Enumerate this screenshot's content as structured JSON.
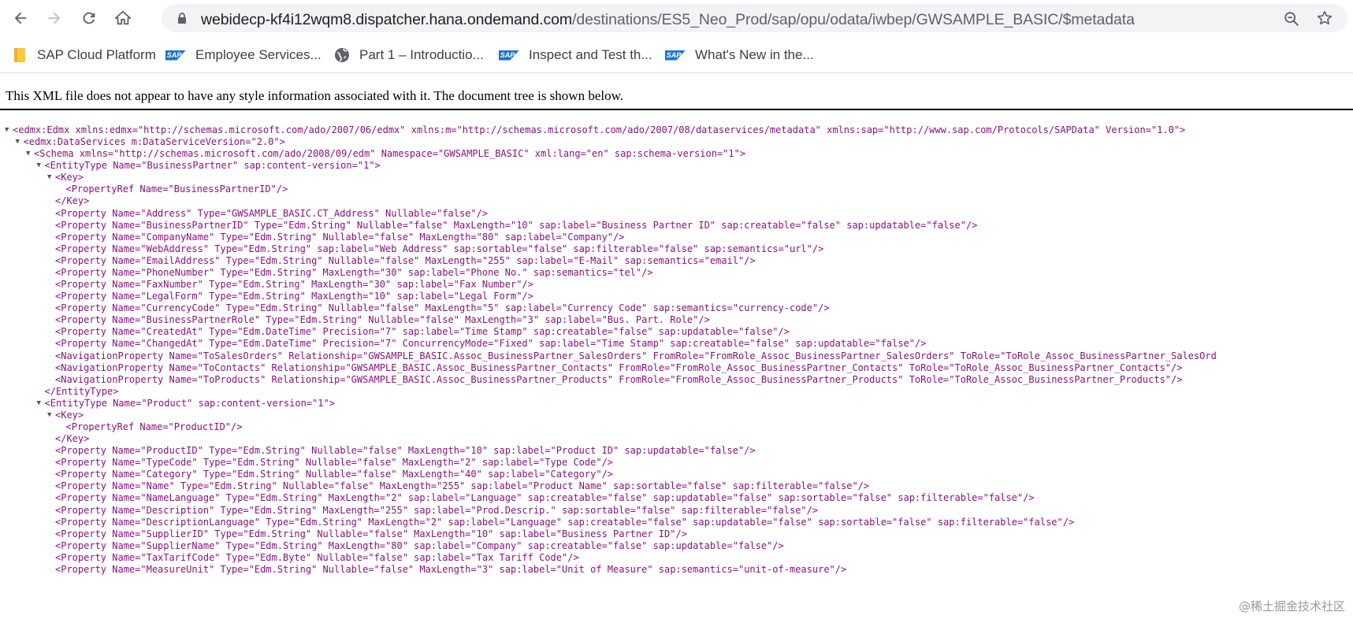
{
  "browser": {
    "url_host": "webidecp-kf4i12wqm8.dispatcher.hana.ondemand.com",
    "url_path": "/destinations/ES5_Neo_Prod/sap/opu/odata/iwbep/GWSAMPLE_BASIC/$metadata",
    "icons": {
      "back": "back-arrow-icon",
      "forward": "forward-arrow-icon",
      "reload": "reload-icon",
      "home": "home-icon",
      "lock": "lock-icon",
      "zoom": "zoom-out-icon",
      "star": "bookmark-star-icon"
    }
  },
  "bookmarks": [
    {
      "label": "SAP Cloud Platform",
      "icon": "folder-icon"
    },
    {
      "label": "Employee Services...",
      "icon": "sap-logo-icon"
    },
    {
      "label": "Part 1 – Introductio...",
      "icon": "globe-icon"
    },
    {
      "label": "Inspect and Test th...",
      "icon": "sap-logo-icon"
    },
    {
      "label": "What's New in the...",
      "icon": "sap-logo-icon"
    }
  ],
  "notice": "This XML file does not appear to have any style information associated with it. The document tree is shown below.",
  "xml_lines": [
    {
      "text": "<edmx:Edmx xmlns:edmx=\"http://schemas.microsoft.com/ado/2007/06/edmx\" xmlns:m=\"http://schemas.microsoft.com/ado/2007/08/dataservices/metadata\" xmlns:sap=\"http://www.sap.com/Protocols/SAPData\" Version=\"1.0\">",
      "level": 0,
      "toggle": true
    },
    {
      "text": "<edmx:DataServices m:DataServiceVersion=\"2.0\">",
      "level": 1,
      "toggle": true
    },
    {
      "text": "<Schema xmlns=\"http://schemas.microsoft.com/ado/2008/09/edm\" Namespace=\"GWSAMPLE_BASIC\" xml:lang=\"en\" sap:schema-version=\"1\">",
      "level": 2,
      "toggle": true
    },
    {
      "text": "<EntityType Name=\"BusinessPartner\" sap:content-version=\"1\">",
      "level": 3,
      "toggle": true
    },
    {
      "text": "<Key>",
      "level": 4,
      "toggle": true
    },
    {
      "text": "<PropertyRef Name=\"BusinessPartnerID\"/>",
      "level": 5,
      "toggle": false
    },
    {
      "text": "</Key>",
      "level": 4,
      "toggle": false
    },
    {
      "text": "<Property Name=\"Address\" Type=\"GWSAMPLE_BASIC.CT_Address\" Nullable=\"false\"/>",
      "level": 4,
      "toggle": false
    },
    {
      "text": "<Property Name=\"BusinessPartnerID\" Type=\"Edm.String\" Nullable=\"false\" MaxLength=\"10\" sap:label=\"Business Partner ID\" sap:creatable=\"false\" sap:updatable=\"false\"/>",
      "level": 4,
      "toggle": false
    },
    {
      "text": "<Property Name=\"CompanyName\" Type=\"Edm.String\" Nullable=\"false\" MaxLength=\"80\" sap:label=\"Company\"/>",
      "level": 4,
      "toggle": false
    },
    {
      "text": "<Property Name=\"WebAddress\" Type=\"Edm.String\" sap:label=\"Web Address\" sap:sortable=\"false\" sap:filterable=\"false\" sap:semantics=\"url\"/>",
      "level": 4,
      "toggle": false
    },
    {
      "text": "<Property Name=\"EmailAddress\" Type=\"Edm.String\" Nullable=\"false\" MaxLength=\"255\" sap:label=\"E-Mail\" sap:semantics=\"email\"/>",
      "level": 4,
      "toggle": false
    },
    {
      "text": "<Property Name=\"PhoneNumber\" Type=\"Edm.String\" MaxLength=\"30\" sap:label=\"Phone No.\" sap:semantics=\"tel\"/>",
      "level": 4,
      "toggle": false
    },
    {
      "text": "<Property Name=\"FaxNumber\" Type=\"Edm.String\" MaxLength=\"30\" sap:label=\"Fax Number\"/>",
      "level": 4,
      "toggle": false
    },
    {
      "text": "<Property Name=\"LegalForm\" Type=\"Edm.String\" MaxLength=\"10\" sap:label=\"Legal Form\"/>",
      "level": 4,
      "toggle": false
    },
    {
      "text": "<Property Name=\"CurrencyCode\" Type=\"Edm.String\" Nullable=\"false\" MaxLength=\"5\" sap:label=\"Currency Code\" sap:semantics=\"currency-code\"/>",
      "level": 4,
      "toggle": false
    },
    {
      "text": "<Property Name=\"BusinessPartnerRole\" Type=\"Edm.String\" Nullable=\"false\" MaxLength=\"3\" sap:label=\"Bus. Part. Role\"/>",
      "level": 4,
      "toggle": false
    },
    {
      "text": "<Property Name=\"CreatedAt\" Type=\"Edm.DateTime\" Precision=\"7\" sap:label=\"Time Stamp\" sap:creatable=\"false\" sap:updatable=\"false\"/>",
      "level": 4,
      "toggle": false
    },
    {
      "text": "<Property Name=\"ChangedAt\" Type=\"Edm.DateTime\" Precision=\"7\" ConcurrencyMode=\"Fixed\" sap:label=\"Time Stamp\" sap:creatable=\"false\" sap:updatable=\"false\"/>",
      "level": 4,
      "toggle": false
    },
    {
      "text": "<NavigationProperty Name=\"ToSalesOrders\" Relationship=\"GWSAMPLE_BASIC.Assoc_BusinessPartner_SalesOrders\" FromRole=\"FromRole_Assoc_BusinessPartner_SalesOrders\" ToRole=\"ToRole_Assoc_BusinessPartner_SalesOrd",
      "level": 4,
      "toggle": false
    },
    {
      "text": "<NavigationProperty Name=\"ToContacts\" Relationship=\"GWSAMPLE_BASIC.Assoc_BusinessPartner_Contacts\" FromRole=\"FromRole_Assoc_BusinessPartner_Contacts\" ToRole=\"ToRole_Assoc_BusinessPartner_Contacts\"/>",
      "level": 4,
      "toggle": false
    },
    {
      "text": "<NavigationProperty Name=\"ToProducts\" Relationship=\"GWSAMPLE_BASIC.Assoc_BusinessPartner_Products\" FromRole=\"FromRole_Assoc_BusinessPartner_Products\" ToRole=\"ToRole_Assoc_BusinessPartner_Products\"/>",
      "level": 4,
      "toggle": false
    },
    {
      "text": "</EntityType>",
      "level": 3,
      "toggle": false
    },
    {
      "text": "<EntityType Name=\"Product\" sap:content-version=\"1\">",
      "level": 3,
      "toggle": true
    },
    {
      "text": "<Key>",
      "level": 4,
      "toggle": true
    },
    {
      "text": "<PropertyRef Name=\"ProductID\"/>",
      "level": 5,
      "toggle": false
    },
    {
      "text": "</Key>",
      "level": 4,
      "toggle": false
    },
    {
      "text": "<Property Name=\"ProductID\" Type=\"Edm.String\" Nullable=\"false\" MaxLength=\"10\" sap:label=\"Product ID\" sap:updatable=\"false\"/>",
      "level": 4,
      "toggle": false
    },
    {
      "text": "<Property Name=\"TypeCode\" Type=\"Edm.String\" Nullable=\"false\" MaxLength=\"2\" sap:label=\"Type Code\"/>",
      "level": 4,
      "toggle": false
    },
    {
      "text": "<Property Name=\"Category\" Type=\"Edm.String\" Nullable=\"false\" MaxLength=\"40\" sap:label=\"Category\"/>",
      "level": 4,
      "toggle": false
    },
    {
      "text": "<Property Name=\"Name\" Type=\"Edm.String\" Nullable=\"false\" MaxLength=\"255\" sap:label=\"Product Name\" sap:sortable=\"false\" sap:filterable=\"false\"/>",
      "level": 4,
      "toggle": false
    },
    {
      "text": "<Property Name=\"NameLanguage\" Type=\"Edm.String\" MaxLength=\"2\" sap:label=\"Language\" sap:creatable=\"false\" sap:updatable=\"false\" sap:sortable=\"false\" sap:filterable=\"false\"/>",
      "level": 4,
      "toggle": false
    },
    {
      "text": "<Property Name=\"Description\" Type=\"Edm.String\" MaxLength=\"255\" sap:label=\"Prod.Descrip.\" sap:sortable=\"false\" sap:filterable=\"false\"/>",
      "level": 4,
      "toggle": false
    },
    {
      "text": "<Property Name=\"DescriptionLanguage\" Type=\"Edm.String\" MaxLength=\"2\" sap:label=\"Language\" sap:creatable=\"false\" sap:updatable=\"false\" sap:sortable=\"false\" sap:filterable=\"false\"/>",
      "level": 4,
      "toggle": false
    },
    {
      "text": "<Property Name=\"SupplierID\" Type=\"Edm.String\" Nullable=\"false\" MaxLength=\"10\" sap:label=\"Business Partner ID\"/>",
      "level": 4,
      "toggle": false
    },
    {
      "text": "<Property Name=\"SupplierName\" Type=\"Edm.String\" MaxLength=\"80\" sap:label=\"Company\" sap:creatable=\"false\" sap:updatable=\"false\"/>",
      "level": 4,
      "toggle": false
    },
    {
      "text": "<Property Name=\"TaxTarifCode\" Type=\"Edm.Byte\" Nullable=\"false\" sap:label=\"Tax Tariff Code\"/>",
      "level": 4,
      "toggle": false
    },
    {
      "text": "<Property Name=\"MeasureUnit\" Type=\"Edm.String\" Nullable=\"false\" MaxLength=\"3\" sap:label=\"Unit of Measure\" sap:semantics=\"unit-of-measure\"/>",
      "level": 4,
      "toggle": false
    }
  ],
  "watermark": "@稀土掘金技术社区"
}
